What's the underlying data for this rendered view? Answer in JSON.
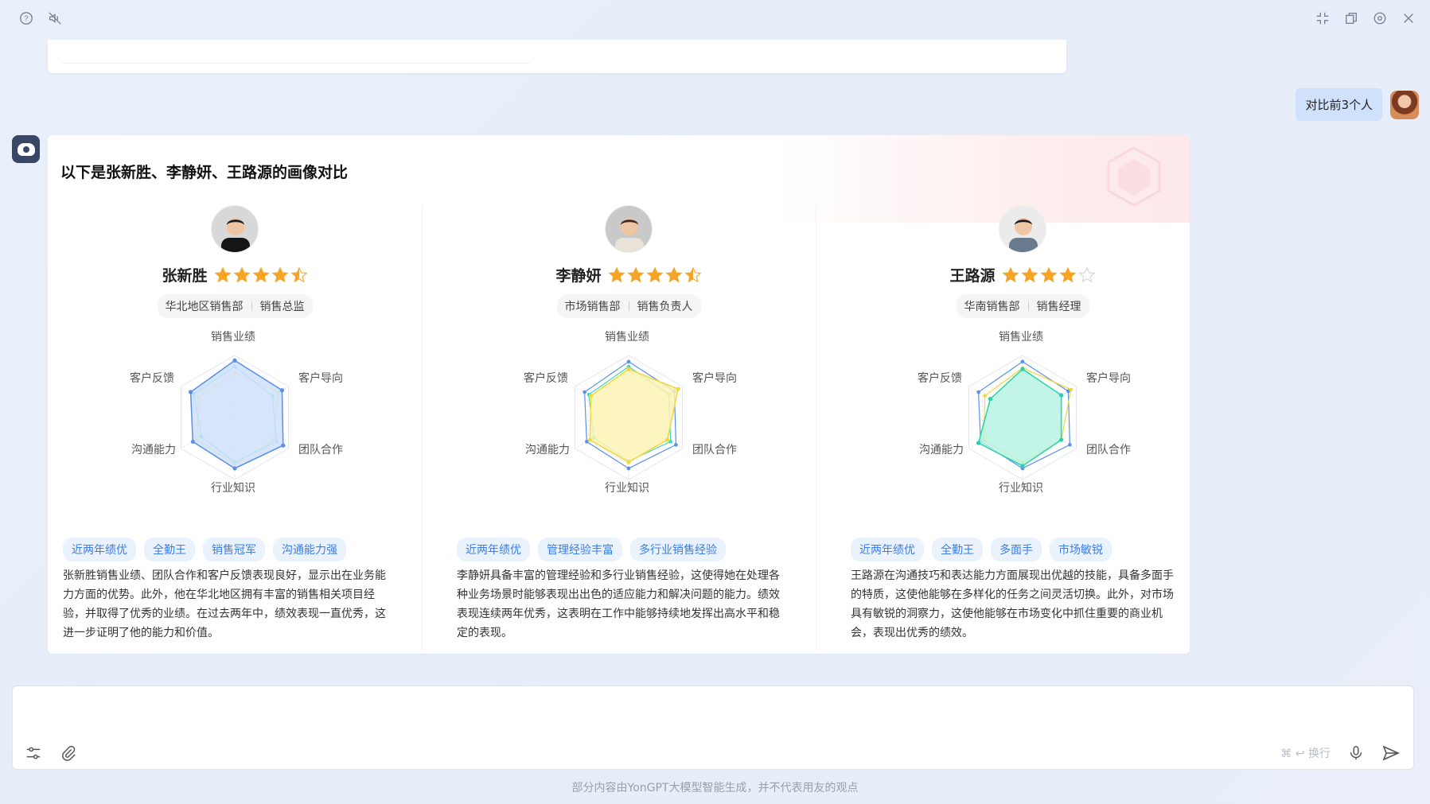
{
  "user_message": "对比前3个人",
  "answer": {
    "title": "以下是张新胜、李静妍、王路源的画像对比",
    "radar_axes": [
      "销售业绩",
      "客户导向",
      "团队合作",
      "行业知识",
      "沟通能力",
      "客户反馈"
    ],
    "people": [
      {
        "name": "张新胜",
        "rating": 4.5,
        "dept": "华北地区销售部",
        "role": "销售总监",
        "tags": [
          "近两年绩优",
          "全勤王",
          "销售冠军",
          "沟通能力强"
        ],
        "desc": "张新胜销售业绩、团队合作和客户反馈表现良好，显示出在业务能力方面的优势。此外，他在华北地区拥有丰富的销售相关项目经验，并取得了优秀的业绩。在过去两年中，绩效表现一直优秀，这进一步证明了他的能力和价值。",
        "fill_color": "#cfe0fa",
        "line_color": "#5b8fe8",
        "other_colors": [
          "#f4e04a",
          "#3fd8c0"
        ],
        "values": [
          0.92,
          0.88,
          0.9,
          0.82,
          0.78,
          0.82
        ],
        "others": [
          [
            0.72,
            0.82,
            0.72,
            0.75,
            0.7,
            0.66
          ],
          [
            0.82,
            0.7,
            0.78,
            0.72,
            0.62,
            0.76
          ]
        ]
      },
      {
        "name": "李静妍",
        "rating": 4.5,
        "dept": "市场销售部",
        "role": "销售负责人",
        "tags": [
          "近两年绩优",
          "管理经验丰富",
          "多行业销售经验"
        ],
        "desc": "李静妍具备丰富的管理经验和多行业销售经验，这使得她在处理各种业务场景时能够表现出出色的适应能力和解决问题的能力。绩效表现连续两年优秀，这表明在工作中能够持续地发挥出高水平和稳定的表现。",
        "fill_color": "#fbf3b4",
        "line_color": "#f0d93a",
        "other_colors": [
          "#5b8fe8",
          "#3fd8c0"
        ],
        "values": [
          0.78,
          0.92,
          0.72,
          0.72,
          0.72,
          0.7
        ],
        "others": [
          [
            0.9,
            0.85,
            0.88,
            0.82,
            0.78,
            0.82
          ],
          [
            0.82,
            0.75,
            0.78,
            0.7,
            0.65,
            0.74
          ]
        ]
      },
      {
        "name": "王路源",
        "rating": 4,
        "dept": "华南销售部",
        "role": "销售经理",
        "tags": [
          "近两年绩优",
          "全勤王",
          "多面手",
          "市场敏锐"
        ],
        "desc": "王路源在沟通技巧和表达能力方面展现出优越的技能，具备多面手的特质，这使他能够在多样化的任务之间灵活切换。此外，对市场具有敏锐的洞察力，这使他能够在市场变化中抓住重要的商业机会，表现出优秀的绩效。",
        "fill_color": "#b7f3e4",
        "line_color": "#27d3a8",
        "other_colors": [
          "#5b8fe8",
          "#f0d93a"
        ],
        "values": [
          0.78,
          0.72,
          0.72,
          0.78,
          0.82,
          0.6
        ],
        "others": [
          [
            0.9,
            0.85,
            0.88,
            0.82,
            0.78,
            0.82
          ],
          [
            0.8,
            0.9,
            0.72,
            0.72,
            0.72,
            0.7
          ]
        ]
      }
    ]
  },
  "input": {
    "placeholder": "",
    "hint": "⌘ ↩ 换行"
  },
  "footer_note": "部分内容由YonGPT大模型智能生成，并不代表用友的观点",
  "icons": [
    "help-icon",
    "mute-icon",
    "shrink-icon",
    "copy-window-icon",
    "settings-icon",
    "close-icon",
    "filter-icon",
    "attach-icon",
    "mic-icon",
    "send-icon"
  ]
}
